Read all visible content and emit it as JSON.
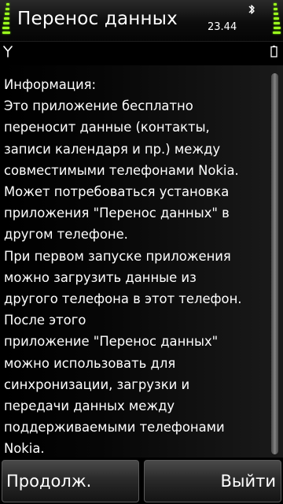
{
  "title_bar": {
    "title": "Перенос данных",
    "time": "23.44",
    "signal_icon": "signal-strength-bars",
    "battery_icon": "battery-level-bars",
    "bluetooth_icon": "bluetooth-icon",
    "accent_color": "#9cff1e"
  },
  "status": {
    "antenna_icon": "antenna-icon",
    "battery_icon": "battery-icon"
  },
  "dialog": {
    "text": "Информация:\nЭто приложение бесплатно\nпереносит данные (контакты,\nзаписи календаря и пр.) между\nсовместимыми телефонами Nokia.\nМожет потребоваться установка\nприложения \"Перенос данных\" в\nдругом телефоне.\nПри первом запуске приложения\nможно загрузить данные из\nдругого телефона в этот телефон.\nПосле этого\nприложение \"Перенос данных\"\nможно использовать для\nсинхронизации, загрузки и\nпередачи данных между\nподдерживаемыми телефонами\nNokia."
  },
  "softkeys": {
    "left": "Продолж.",
    "right": "Выйти"
  }
}
